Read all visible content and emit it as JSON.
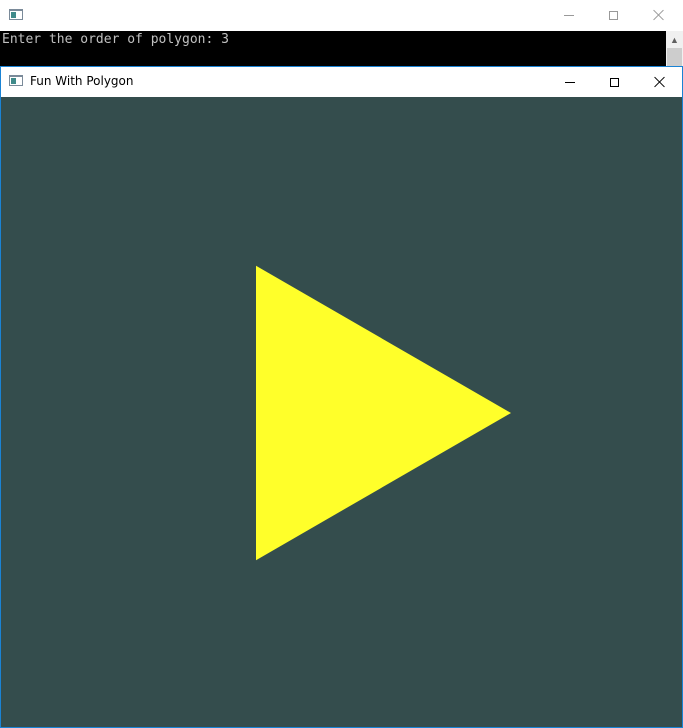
{
  "console": {
    "title": "",
    "prompt_text": "Enter the order of polygon: 3",
    "minimize_label": "",
    "maximize_label": "",
    "close_label": ""
  },
  "gl_window": {
    "title": "Fun With Polygon",
    "background_color": "#344d4d",
    "polygon": {
      "order": 3,
      "fill_color": "#ffff2a"
    }
  }
}
